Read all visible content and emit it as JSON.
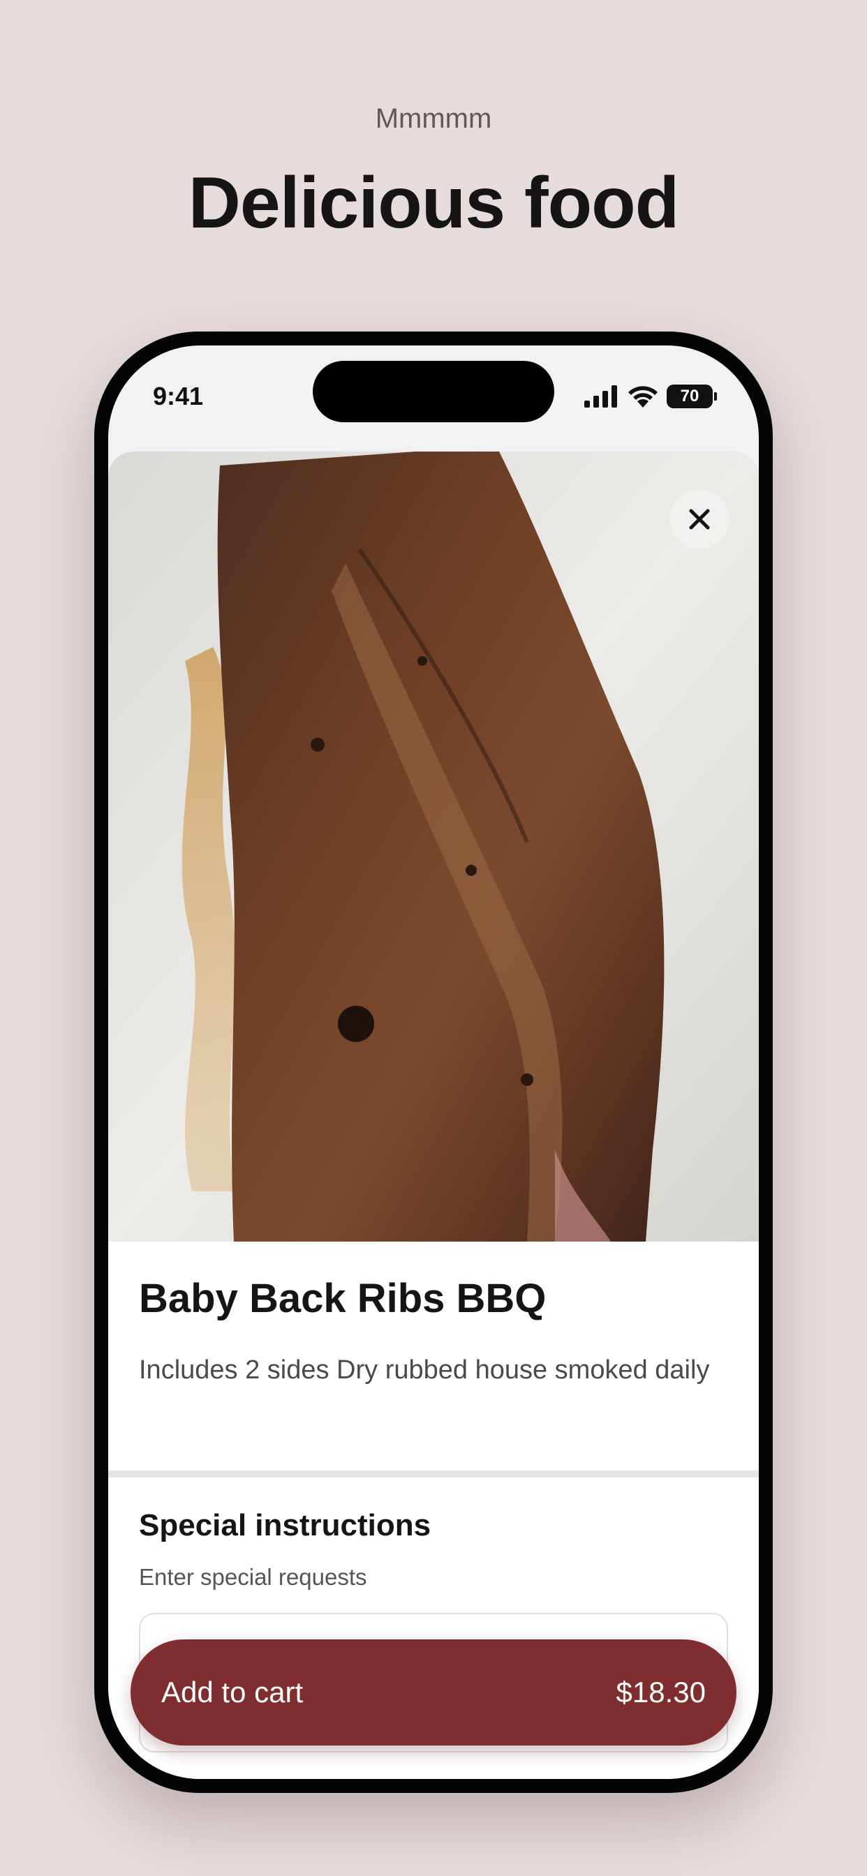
{
  "promo": {
    "eyebrow": "Mmmmm",
    "headline": "Delicious food"
  },
  "status_bar": {
    "time": "9:41",
    "battery": "70",
    "icons": [
      "cellular-signal-icon",
      "wifi-icon",
      "battery-icon"
    ]
  },
  "item": {
    "image": "baby-back-ribs-photo",
    "name": "Baby Back Ribs BBQ",
    "description": "Includes 2 sides Dry rubbed house smoked daily"
  },
  "special_instructions": {
    "title": "Special instructions",
    "subtitle": "Enter special requests",
    "value": ""
  },
  "cta": {
    "label": "Add to cart",
    "price": "$18.30"
  },
  "colors": {
    "background": "#e6dcdc",
    "accent": "#7f2d2f"
  }
}
